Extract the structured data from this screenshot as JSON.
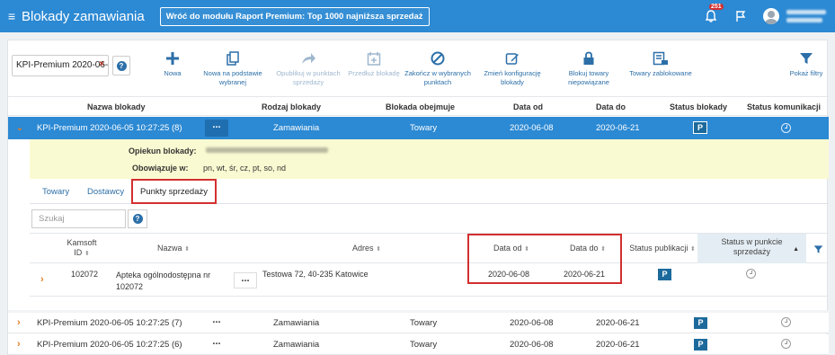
{
  "app": {
    "title": "Blokady zamawiania",
    "back_button": "Wróć do modułu Raport Premium: Top 1000 najniższa sprzedaż",
    "notifications_count": "251"
  },
  "toolbar": {
    "selector_value": "KPI-Premium 2020-06-0",
    "actions": [
      {
        "label1": "Nowa",
        "label2": ""
      },
      {
        "label1": "Nowa na podstawie",
        "label2": "wybranej"
      },
      {
        "label1": "Opublikuj w punktach",
        "label2": "sprzedaży"
      },
      {
        "label1": "Przedłuż blokadę",
        "label2": ""
      },
      {
        "label1": "Zakończ w wybranych",
        "label2": "punktach"
      },
      {
        "label1": "Zmień konfigurację",
        "label2": "blokady"
      },
      {
        "label1": "Blokuj towary",
        "label2": "niepowiązane"
      },
      {
        "label1": "Towary zablokowane",
        "label2": ""
      },
      {
        "label1": "Pokaż filtry",
        "label2": ""
      }
    ]
  },
  "grid": {
    "headers": [
      "Nazwa blokady",
      "Rodzaj blokady",
      "Blokada obejmuje",
      "Data od",
      "Data do",
      "Status blokady",
      "Status komunikacji"
    ],
    "selected_row": {
      "name": "KPI-Premium 2020-06-05 10:27:25 (8)",
      "type": "Zamawiania",
      "scope": "Towary",
      "date_from": "2020-06-08",
      "date_to": "2020-06-21",
      "status": "P"
    },
    "rows": [
      {
        "name": "KPI-Premium 2020-06-05 10:27:25 (7)",
        "type": "Zamawiania",
        "scope": "Towary",
        "date_from": "2020-06-08",
        "date_to": "2020-06-21",
        "status": "P"
      },
      {
        "name": "KPI-Premium 2020-06-05 10:27:25 (6)",
        "type": "Zamawiania",
        "scope": "Towary",
        "date_from": "2020-06-08",
        "date_to": "2020-06-21",
        "status": "P"
      }
    ]
  },
  "details": {
    "guardian_label": "Opiekun blokady:",
    "valid_label": "Obowiązuje w:",
    "valid_value": "pn, wt, śr, cz, pt, so, nd"
  },
  "tabs": [
    "Towary",
    "Dostawcy",
    "Punkty sprzedaży"
  ],
  "subgrid": {
    "search_placeholder": "Szukaj",
    "headers": {
      "kamsoft_id_1": "Kamsoft",
      "kamsoft_id_2": "ID",
      "name": "Nazwa",
      "address": "Adres",
      "date_from": "Data od",
      "date_to": "Data do",
      "pub_status": "Status publikacji",
      "pkt_status_1": "Status w punkcie",
      "pkt_status_2": "sprzedaży"
    },
    "row": {
      "id": "102072",
      "name_1": "Apteka ogólnodostępna nr",
      "name_2": "102072",
      "address": "Testowa 72, 40-235 Katowice",
      "date_from": "2020-06-08",
      "date_to": "2020-06-21",
      "pub_status": "P"
    }
  },
  "colors": {
    "accent": "#2c89d3",
    "highlight": "#d32f2f",
    "details_bg": "#fafad2"
  }
}
